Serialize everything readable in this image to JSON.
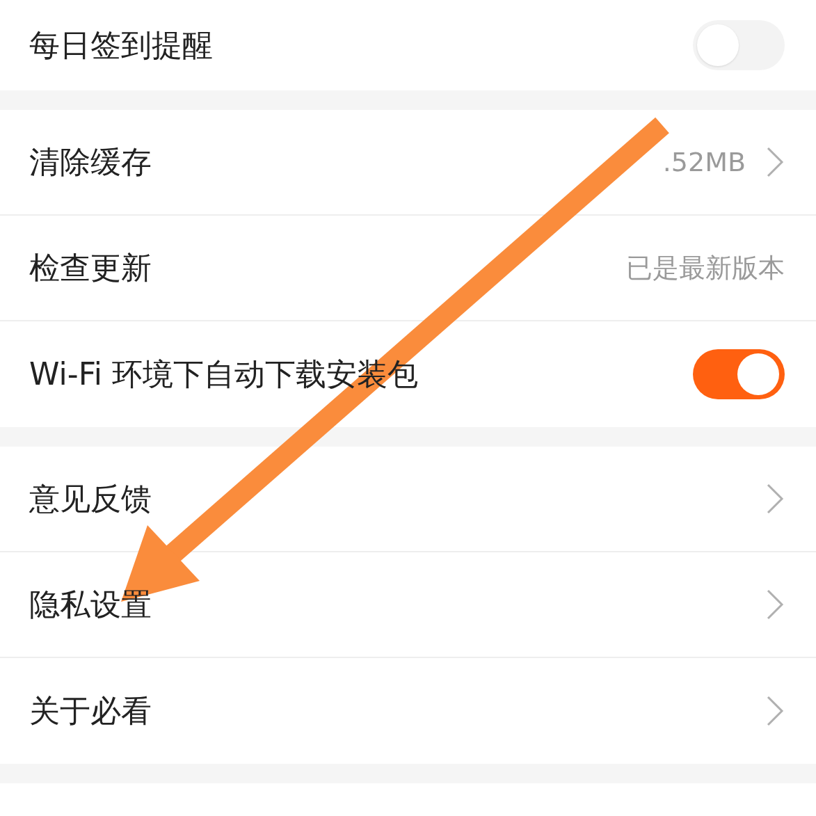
{
  "groups": [
    {
      "items": [
        {
          "kind": "toggle",
          "label": "每日签到提醒",
          "on": false
        }
      ]
    },
    {
      "items": [
        {
          "kind": "link",
          "label": "清除缓存",
          "value": ".52MB"
        },
        {
          "kind": "value",
          "label": "检查更新",
          "value": "已是最新版本"
        },
        {
          "kind": "toggle",
          "label": "Wi-Fi 环境下自动下载安装包",
          "on": true
        }
      ]
    },
    {
      "items": [
        {
          "kind": "link",
          "label": "意见反馈"
        },
        {
          "kind": "link",
          "label": "隐私设置"
        },
        {
          "kind": "link",
          "label": "关于必看"
        }
      ]
    }
  ]
}
